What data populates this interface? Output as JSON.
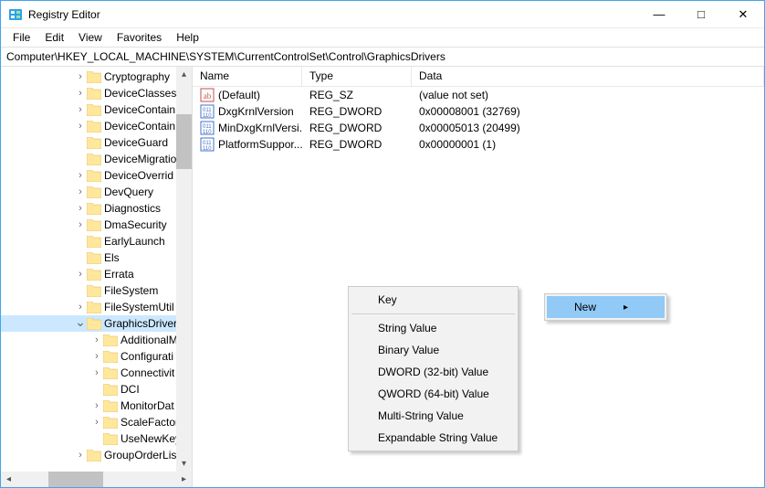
{
  "window": {
    "title": "Registry Editor"
  },
  "menu": {
    "file": "File",
    "edit": "Edit",
    "view": "View",
    "favorites": "Favorites",
    "help": "Help"
  },
  "address": "Computer\\HKEY_LOCAL_MACHINE\\SYSTEM\\CurrentControlSet\\Control\\GraphicsDrivers",
  "tree": [
    {
      "indent": 80,
      "exp": ">",
      "label": "Cryptography"
    },
    {
      "indent": 80,
      "exp": ">",
      "label": "DeviceClasses"
    },
    {
      "indent": 80,
      "exp": ">",
      "label": "DeviceContain"
    },
    {
      "indent": 80,
      "exp": ">",
      "label": "DeviceContain"
    },
    {
      "indent": 80,
      "exp": "",
      "label": "DeviceGuard"
    },
    {
      "indent": 80,
      "exp": "",
      "label": "DeviceMigratio"
    },
    {
      "indent": 80,
      "exp": ">",
      "label": "DeviceOverrid"
    },
    {
      "indent": 80,
      "exp": ">",
      "label": "DevQuery"
    },
    {
      "indent": 80,
      "exp": ">",
      "label": "Diagnostics"
    },
    {
      "indent": 80,
      "exp": ">",
      "label": "DmaSecurity"
    },
    {
      "indent": 80,
      "exp": "",
      "label": "EarlyLaunch"
    },
    {
      "indent": 80,
      "exp": "",
      "label": "Els"
    },
    {
      "indent": 80,
      "exp": ">",
      "label": "Errata"
    },
    {
      "indent": 80,
      "exp": "",
      "label": "FileSystem"
    },
    {
      "indent": 80,
      "exp": ">",
      "label": "FileSystemUtil"
    },
    {
      "indent": 80,
      "exp": "v",
      "label": "GraphicsDrivers",
      "selected": true
    },
    {
      "indent": 98,
      "exp": ">",
      "label": "AdditionalM"
    },
    {
      "indent": 98,
      "exp": ">",
      "label": "Configurati"
    },
    {
      "indent": 98,
      "exp": ">",
      "label": "Connectivit"
    },
    {
      "indent": 98,
      "exp": "",
      "label": "DCI"
    },
    {
      "indent": 98,
      "exp": ">",
      "label": "MonitorDat"
    },
    {
      "indent": 98,
      "exp": ">",
      "label": "ScaleFactor"
    },
    {
      "indent": 98,
      "exp": "",
      "label": "UseNewKey"
    },
    {
      "indent": 80,
      "exp": ">",
      "label": "GroupOrderLis"
    }
  ],
  "list": {
    "columns": {
      "name": "Name",
      "type": "Type",
      "data": "Data"
    },
    "rows": [
      {
        "icon": "string",
        "name": "(Default)",
        "type": "REG_SZ",
        "data": "(value not set)"
      },
      {
        "icon": "binary",
        "name": "DxgKrnlVersion",
        "type": "REG_DWORD",
        "data": "0x00008001 (32769)"
      },
      {
        "icon": "binary",
        "name": "MinDxgKrnlVersi...",
        "type": "REG_DWORD",
        "data": "0x00005013 (20499)"
      },
      {
        "icon": "binary",
        "name": "PlatformSuppor...",
        "type": "REG_DWORD",
        "data": "0x00000001 (1)"
      }
    ]
  },
  "context": {
    "new": "New"
  },
  "submenu": [
    "Key",
    "---",
    "String Value",
    "Binary Value",
    "DWORD (32-bit) Value",
    "QWORD (64-bit) Value",
    "Multi-String Value",
    "Expandable String Value"
  ]
}
